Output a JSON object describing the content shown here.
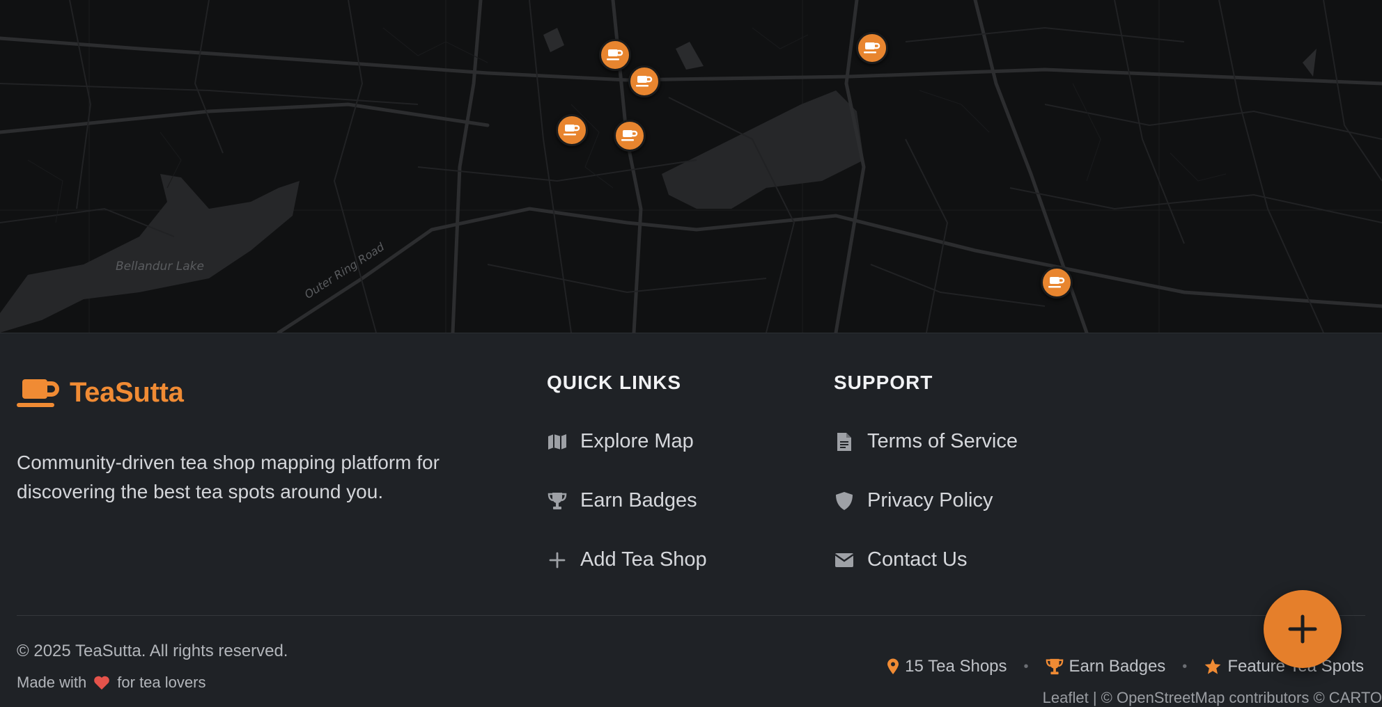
{
  "map": {
    "labels": {
      "lake": "Bellandur Lake",
      "road": "Outer Ring Road"
    },
    "marker_icon": "tea-cup-icon",
    "marker_color": "#e8852f"
  },
  "footer": {
    "brand": {
      "name": "TeaSutta",
      "icon": "tea-cup-icon",
      "color": "#f08b34"
    },
    "tagline": "Community-driven tea shop mapping platform for discovering the best tea spots around you.",
    "quick_links": {
      "title": "QUICK LINKS",
      "items": [
        {
          "label": "Explore Map",
          "icon": "map-icon"
        },
        {
          "label": "Earn Badges",
          "icon": "trophy-icon"
        },
        {
          "label": "Add Tea Shop",
          "icon": "plus-icon"
        }
      ]
    },
    "support": {
      "title": "SUPPORT",
      "items": [
        {
          "label": "Terms of Service",
          "icon": "document-icon"
        },
        {
          "label": "Privacy Policy",
          "icon": "shield-icon"
        },
        {
          "label": "Contact Us",
          "icon": "envelope-icon"
        }
      ]
    },
    "copyright": "© 2025 TeaSutta. All rights reserved.",
    "made_with": {
      "before": "Made with",
      "after": "for tea lovers",
      "icon": "heart-icon",
      "heart_color": "#e5534b"
    },
    "stats": [
      {
        "label": "15 Tea Shops",
        "icon": "map-pin-icon"
      },
      {
        "label": "Earn Badges",
        "icon": "trophy-icon"
      },
      {
        "label": "Feature Tea Spots",
        "icon": "star-icon"
      }
    ],
    "separator": "•",
    "attribution": "Leaflet | © OpenStreetMap contributors © CARTO"
  },
  "fab": {
    "icon": "plus-icon",
    "color": "#e57f2b"
  }
}
